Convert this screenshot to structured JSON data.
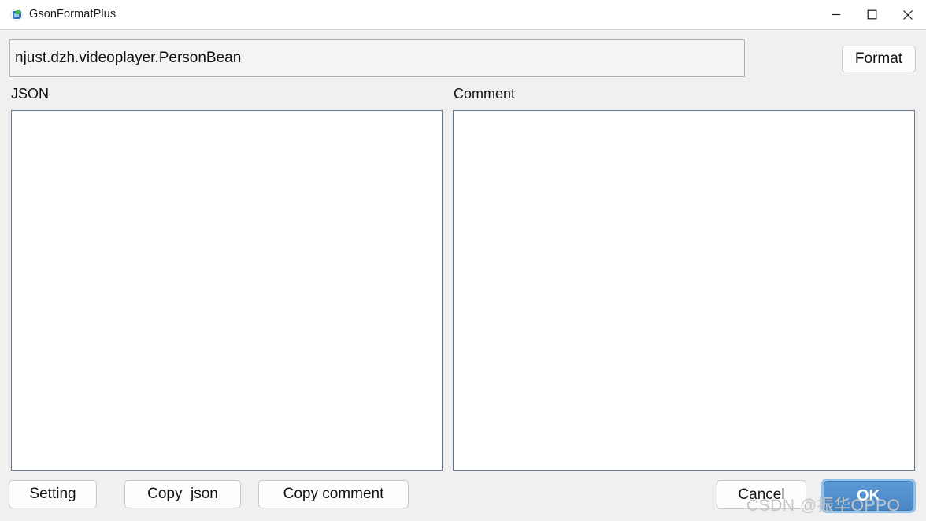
{
  "window": {
    "title": "GsonFormatPlus",
    "icon": "app-icon",
    "controls": {
      "minimize": "minimize-icon",
      "maximize": "maximize-icon",
      "close": "close-icon"
    }
  },
  "class_input": {
    "value": "njust.dzh.videoplayer.PersonBean",
    "placeholder": ""
  },
  "toolbar": {
    "format_label": "Format"
  },
  "panels": {
    "json_label": "JSON",
    "comment_label": "Comment",
    "json_value": "",
    "comment_value": ""
  },
  "footer": {
    "setting_label": "Setting",
    "copy_json_label": "Copy  json",
    "copy_comment_label": "Copy comment",
    "cancel_label": "Cancel",
    "ok_label": "OK"
  },
  "watermark": {
    "text": "CSDN @振华OPPO"
  },
  "colors": {
    "accent": "#4a86c4",
    "accent_ring": "#8fc0ea",
    "background": "#f0f0f0",
    "titlebar": "#ffffff",
    "textarea_border": "#64748b",
    "button_border": "#c8c8c8",
    "watermark": "#c6c6c6"
  }
}
